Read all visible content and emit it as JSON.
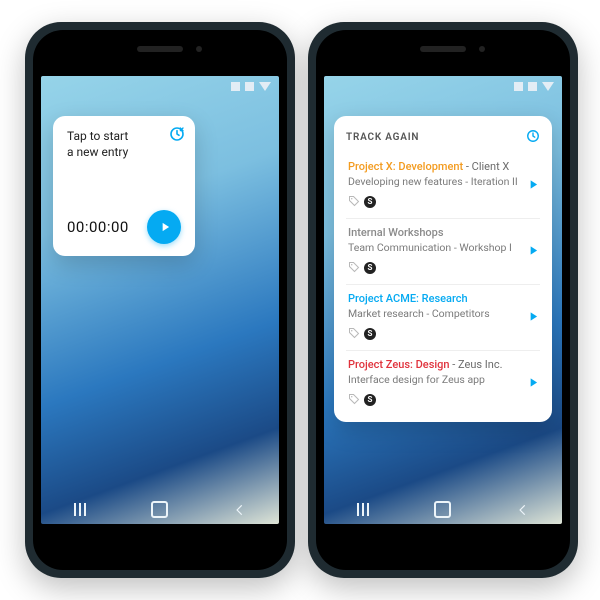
{
  "colors": {
    "accent": "#05aaf2",
    "orange": "#f39b1f",
    "red": "#e0323c",
    "gray": "#8a8a8a"
  },
  "widget_new": {
    "prompt_line1": "Tap to start",
    "prompt_line2": "a new entry",
    "timer": "00:00:00"
  },
  "widget_list": {
    "title": "TRACK AGAIN",
    "entries": [
      {
        "project": "Project X: Development",
        "client": " - Client X",
        "project_color": "c-orange",
        "desc": "Developing new features - Iteration II"
      },
      {
        "project": "Internal Workshops",
        "client": "",
        "project_color": "c-gray",
        "desc": "Team Communication - Workshop I"
      },
      {
        "project": "Project ACME: Research",
        "client": "",
        "project_color": "c-blue",
        "desc": "Market research - Competitors"
      },
      {
        "project": "Project Zeus: Design",
        "client": " - Zeus Inc.",
        "project_color": "c-red",
        "desc": "Interface design for Zeus app"
      }
    ]
  },
  "icons": {
    "bill_glyph": "S"
  }
}
